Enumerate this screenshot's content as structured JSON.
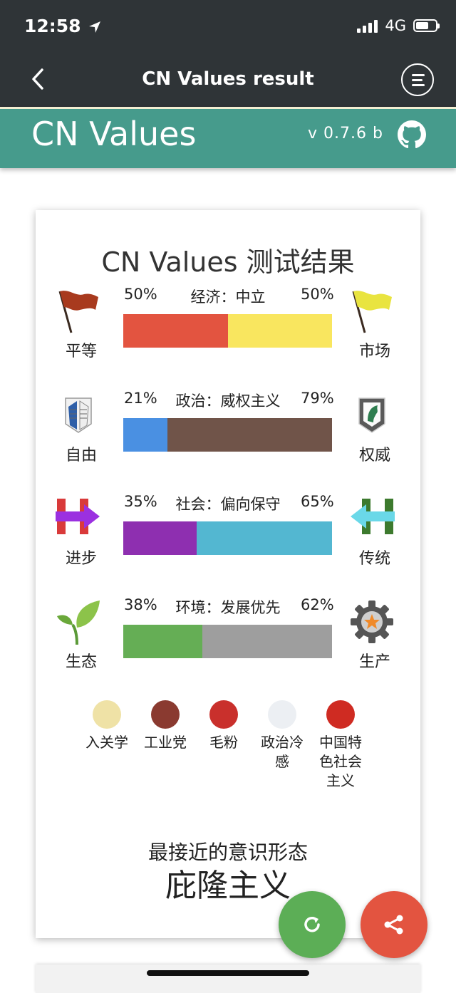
{
  "status_bar": {
    "time": "12:58",
    "network": "4G"
  },
  "nav": {
    "title": "CN Values result"
  },
  "app": {
    "name": "CN Values",
    "version": "v 0.7.6 b"
  },
  "card": {
    "title": "CN Values 测试结果",
    "axes": [
      {
        "left_label": "平等",
        "right_label": "市场",
        "left_pct": "50%",
        "right_pct": "50%",
        "axis_label": "经济：中立",
        "left_value": 0.5,
        "left_color": "#e35440",
        "right_color": "#f9e65f",
        "left_icon": "red-flag-icon",
        "right_icon": "yellow-flag-icon"
      },
      {
        "left_label": "自由",
        "right_label": "权威",
        "left_pct": "21%",
        "right_pct": "79%",
        "axis_label": "政治：威权主义",
        "left_value": 0.21,
        "left_color": "#4a90e2",
        "right_color": "#705449",
        "left_icon": "wings-emblem-icon",
        "right_icon": "horse-emblem-icon"
      },
      {
        "left_label": "进步",
        "right_label": "传统",
        "left_pct": "35%",
        "right_pct": "65%",
        "axis_label": "社会：偏向保守",
        "left_value": 0.35,
        "left_color": "#8e2fb0",
        "right_color": "#53b7d1",
        "left_icon": "progress-arrow-icon",
        "right_icon": "tradition-arrow-icon"
      },
      {
        "left_label": "生态",
        "right_label": "生产",
        "left_pct": "38%",
        "right_pct": "62%",
        "axis_label": "环境：发展优先",
        "left_value": 0.38,
        "left_color": "#65ae55",
        "right_color": "#9e9e9e",
        "left_icon": "sprout-icon",
        "right_icon": "gear-icon"
      }
    ],
    "badges": [
      {
        "name": "入关学",
        "icon": "seal-badge-icon"
      },
      {
        "name": "工业党",
        "icon": "industry-badge-icon"
      },
      {
        "name": "毛粉",
        "icon": "portrait-badge-icon"
      },
      {
        "name": "政治冷感",
        "icon": "anime-badge-icon"
      },
      {
        "name": "中国特色社会主义",
        "icon": "hammer-sickle-badge-icon"
      }
    ],
    "closest_title": "最接近的意识形态",
    "closest_value": "庇隆主义"
  },
  "fab": {
    "refresh_icon": "refresh-icon",
    "share_icon": "share-icon",
    "refresh_color": "#5cae56",
    "share_color": "#e35440"
  }
}
